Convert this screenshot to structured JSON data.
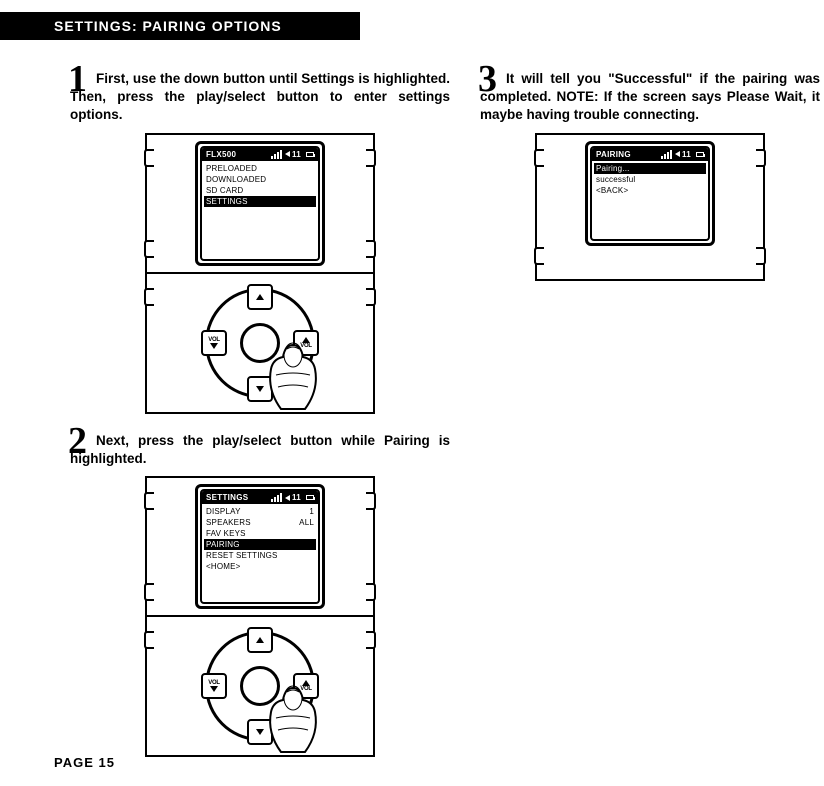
{
  "header": {
    "title": "SETTINGS: PAIRING OPTIONS"
  },
  "footer": {
    "page_label": "PAGE 15"
  },
  "steps": {
    "s1": {
      "num": "1",
      "text": "First, use the down button until Settings is highlighted. Then, press the play/select button to enter settings options."
    },
    "s2": {
      "num": "2",
      "text": "Next, press the play/select button while Pairing is highlighted."
    },
    "s3": {
      "num": "3",
      "text": "It will tell you \"Successful\" if the pairing was completed. NOTE: If the screen says Please Wait, it maybe having trouble connecting."
    }
  },
  "lcd": {
    "volume": "11",
    "screen1": {
      "title": "FLX500",
      "lines": [
        "PRELOADED",
        "DOWNLOADED",
        "SD CARD"
      ],
      "highlight": "SETTINGS"
    },
    "screen2": {
      "title": "SETTINGS",
      "rows": [
        {
          "l": "DISPLAY",
          "r": "1"
        },
        {
          "l": "SPEAKERS",
          "r": "ALL"
        },
        {
          "l": "FAV KEYS",
          "r": ""
        }
      ],
      "highlight": "PAIRING",
      "after": [
        "RESET SETTINGS",
        "<HOME>"
      ]
    },
    "screen3": {
      "title": "PAIRING",
      "highlight": "Pairing...",
      "lines": [
        "successful",
        "<BACK>"
      ]
    }
  },
  "dpad": {
    "vol": "VOL"
  }
}
